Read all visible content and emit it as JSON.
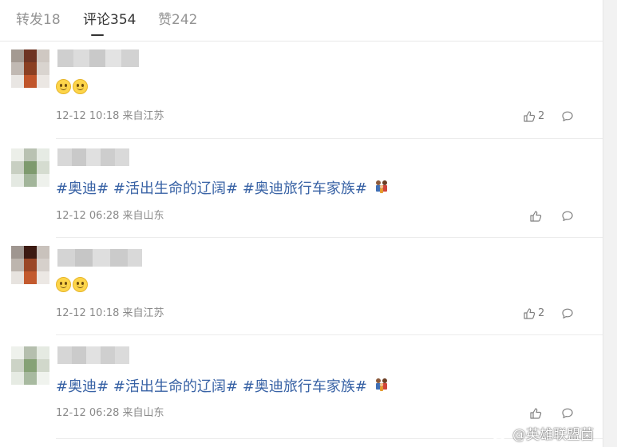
{
  "tabs": {
    "repost": "转发18",
    "comment": "评论354",
    "like": "赞242"
  },
  "comments": [
    {
      "emoji_count": 2,
      "date": "12-12 10:18",
      "source": "来自江苏",
      "likes": "2"
    },
    {
      "hashtags": [
        "#奥迪#",
        "#活出生命的辽阔#",
        "#奥迪旅行车家族#"
      ],
      "date": "12-12 06:28",
      "source": "来自山东",
      "likes": ""
    },
    {
      "emoji_count": 2,
      "date": "12-12 10:18",
      "source": "来自江苏",
      "likes": "2"
    },
    {
      "hashtags": [
        "#奥迪#",
        "#活出生命的辽阔#",
        "#奥迪旅行车家族#"
      ],
      "date": "12-12 06:28",
      "source": "来自山东",
      "likes": ""
    }
  ],
  "watermark": {
    "handle": "@英雄联盟菌",
    "icon": "weibo-icon"
  },
  "colors": {
    "hashtag": "#3862a5",
    "text": "#333333",
    "meta": "#8a8a8a",
    "tab_inactive": "#939393",
    "tab_active": "#333333"
  }
}
